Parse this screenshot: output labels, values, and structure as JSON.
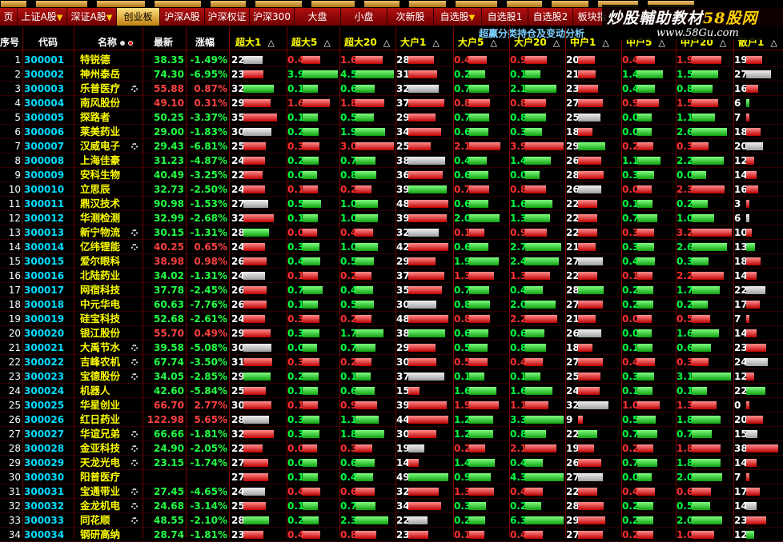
{
  "watermark": {
    "line1a": "炒股輔助教材",
    "line1b": "58股网",
    "line2": "www.58Gu.com"
  },
  "tabs": [
    {
      "label": "页"
    },
    {
      "label": "上证A股",
      "arrow": "▼"
    },
    {
      "label": "深证A股",
      "arrow": "▼"
    },
    {
      "label": "创业板",
      "active": true
    },
    {
      "label": "沪深A股"
    },
    {
      "label": "沪深权证"
    },
    {
      "label": "沪深300"
    },
    {
      "label": "大盘"
    },
    {
      "label": "小盘"
    },
    {
      "label": "次新股"
    },
    {
      "label": "自选股",
      "arrow": "▼"
    },
    {
      "label": "自选股1"
    },
    {
      "label": "自选股2"
    },
    {
      "label": "板块指"
    }
  ],
  "subtitle": "超赢分类持仓及变动分析",
  "columns": {
    "seq": "序号",
    "code": "代码",
    "name": "名称",
    "price": "最新",
    "pct": "涨幅",
    "groups": [
      "超大1",
      "超大5",
      "超大20",
      "大户1",
      "大户5",
      "大户20",
      "中户1",
      "中户5",
      "中户20",
      "散户1"
    ],
    "sort_icon": "△"
  },
  "colors": {
    "up": "#ff4040",
    "down": "#22ff44",
    "code": "#00ddff",
    "name": "#ffff00"
  },
  "rows": [
    {
      "seq": "1",
      "code": "300001",
      "name": "特锐德",
      "price": "38.35",
      "pct": "-1.49%",
      "gear": false,
      "n": [
        22,
        "0.4",
        "1.6",
        28,
        "0.4",
        "0.9",
        20,
        "0.4",
        "1.9",
        19
      ]
    },
    {
      "seq": "2",
      "code": "300002",
      "name": "神州泰岳",
      "price": "74.30",
      "pct": "-6.95%",
      "gear": false,
      "n": [
        23,
        "3.9",
        "4.5",
        31,
        "0.2",
        "0.1",
        21,
        "1.4",
        "1.5",
        27
      ]
    },
    {
      "seq": "3",
      "code": "300003",
      "name": "乐普医疗",
      "price": "55.88",
      "pct": "0.87%",
      "gear": true,
      "n": [
        32,
        "0.1",
        "0.6",
        32,
        "0.7",
        "2.1",
        23,
        "0.4",
        "0.8",
        16
      ]
    },
    {
      "seq": "4",
      "code": "300004",
      "name": "南风股份",
      "price": "49.10",
      "pct": "0.31%",
      "gear": false,
      "n": [
        29,
        "1.6",
        "1.8",
        37,
        "0.8",
        "0.8",
        27,
        "0.9",
        "1.5",
        6
      ]
    },
    {
      "seq": "5",
      "code": "300005",
      "name": "探路者",
      "price": "50.25",
      "pct": "-3.37%",
      "gear": false,
      "n": [
        35,
        "0.1",
        "0.5",
        29,
        "0.7",
        "0.8",
        25,
        "0.0",
        "1.1",
        7
      ]
    },
    {
      "seq": "6",
      "code": "300006",
      "name": "莱美药业",
      "price": "29.00",
      "pct": "-1.83%",
      "gear": false,
      "n": [
        30,
        "0.2",
        "1.9",
        34,
        "0.6",
        "0.3",
        18,
        "0.0",
        "2.6",
        18
      ]
    },
    {
      "seq": "7",
      "code": "300007",
      "name": "汉威电子",
      "price": "29.43",
      "pct": "-6.81%",
      "gear": true,
      "n": [
        25,
        "0.3",
        "3.0",
        25,
        "2.1",
        "3.9",
        29,
        "0.2",
        "0.3",
        20
      ]
    },
    {
      "seq": "8",
      "code": "300008",
      "name": "上海佳豪",
      "price": "31.23",
      "pct": "-4.87%",
      "gear": false,
      "n": [
        24,
        "0.2",
        "0.7",
        38,
        "0.4",
        "1.4",
        26,
        "1.1",
        "2.2",
        12
      ]
    },
    {
      "seq": "9",
      "code": "300009",
      "name": "安科生物",
      "price": "40.49",
      "pct": "-3.25%",
      "gear": false,
      "n": [
        22,
        "0.0",
        "0.8",
        36,
        "0.6",
        "0.0",
        28,
        "0.3",
        "0.0",
        14
      ]
    },
    {
      "seq": "10",
      "code": "300010",
      "name": "立思辰",
      "price": "32.73",
      "pct": "-2.50%",
      "gear": false,
      "n": [
        24,
        "0.1",
        "0.2",
        39,
        "0.7",
        "0.8",
        26,
        "0.0",
        "2.3",
        16
      ]
    },
    {
      "seq": "11",
      "code": "300011",
      "name": "鼎汉技术",
      "price": "90.98",
      "pct": "-1.53%",
      "gear": false,
      "n": [
        27,
        "0.5",
        "1.0",
        48,
        "0.6",
        "1.6",
        22,
        "0.1",
        "0.2",
        3
      ]
    },
    {
      "seq": "12",
      "code": "300012",
      "name": "华测检测",
      "price": "32.99",
      "pct": "-2.68%",
      "gear": false,
      "n": [
        32,
        "0.1",
        "1.0",
        39,
        "2.0",
        "1.3",
        22,
        "0.7",
        "1.0",
        6
      ]
    },
    {
      "seq": "13",
      "code": "300013",
      "name": "新宁物流",
      "price": "30.15",
      "pct": "-1.31%",
      "gear": true,
      "n": [
        28,
        "0.0",
        "0.4",
        32,
        "0.1",
        "0.9",
        22,
        "0.3",
        "3.2",
        10
      ]
    },
    {
      "seq": "14",
      "code": "300014",
      "name": "亿纬锂能",
      "price": "40.25",
      "pct": "0.65%",
      "gear": true,
      "n": [
        24,
        "0.3",
        "1.0",
        42,
        "0.6",
        "2.7",
        21,
        "0.3",
        "2.6",
        13
      ]
    },
    {
      "seq": "15",
      "code": "300015",
      "name": "爱尔眼科",
      "price": "38.98",
      "pct": "0.98%",
      "gear": false,
      "n": [
        26,
        "0.4",
        "0.5",
        29,
        "1.9",
        "2.4",
        27,
        "0.4",
        "0.3",
        18
      ]
    },
    {
      "seq": "16",
      "code": "300016",
      "name": "北陆药业",
      "price": "34.02",
      "pct": "-1.31%",
      "gear": false,
      "n": [
        24,
        "0.1",
        "0.2",
        37,
        "1.3",
        "1.3",
        22,
        "0.1",
        "2.2",
        14
      ]
    },
    {
      "seq": "17",
      "code": "300017",
      "name": "网宿科技",
      "price": "37.78",
      "pct": "-2.45%",
      "gear": false,
      "n": [
        26,
        "0.7",
        "0.4",
        35,
        "0.7",
        "0.4",
        28,
        "0.2",
        "1.7",
        22
      ]
    },
    {
      "seq": "18",
      "code": "300018",
      "name": "中元华电",
      "price": "60.63",
      "pct": "-7.76%",
      "gear": false,
      "n": [
        26,
        "0.1",
        "0.5",
        30,
        "0.8",
        "2.0",
        27,
        "0.2",
        "0.2",
        17
      ]
    },
    {
      "seq": "19",
      "code": "300019",
      "name": "硅宝科技",
      "price": "52.68",
      "pct": "-2.61%",
      "gear": false,
      "n": [
        24,
        "0.3",
        "0.2",
        48,
        "0.8",
        "2.2",
        21,
        "0.0",
        "0.5",
        7
      ]
    },
    {
      "seq": "20",
      "code": "300020",
      "name": "银江股份",
      "price": "55.70",
      "pct": "0.49%",
      "gear": false,
      "n": [
        29,
        "0.3",
        "1.7",
        38,
        "0.6",
        "0.6",
        26,
        "0.0",
        "1.6",
        14
      ]
    },
    {
      "seq": "21",
      "code": "300021",
      "name": "大禹节水",
      "price": "39.58",
      "pct": "-5.08%",
      "gear": true,
      "n": [
        30,
        "0.0",
        "0.7",
        29,
        "0.5",
        "0.8",
        18,
        "0.1",
        "0.6",
        23
      ]
    },
    {
      "seq": "22",
      "code": "300022",
      "name": "吉峰农机",
      "price": "67.74",
      "pct": "-3.50%",
      "gear": true,
      "n": [
        31,
        "0.3",
        "0.2",
        30,
        "0.5",
        "0.4",
        27,
        "0.4",
        "0.3",
        24
      ]
    },
    {
      "seq": "23",
      "code": "300023",
      "name": "宝德股份",
      "price": "34.05",
      "pct": "-2.85%",
      "gear": true,
      "n": [
        29,
        "0.2",
        "0.1",
        37,
        "0.1",
        "0.1",
        25,
        "0.3",
        "3.1",
        12
      ]
    },
    {
      "seq": "24",
      "code": "300024",
      "name": "机器人",
      "price": "42.60",
      "pct": "-5.84%",
      "gear": false,
      "n": [
        25,
        "0.1",
        "0.6",
        15,
        "1.6",
        "1.6",
        24,
        "0.1",
        "0.1",
        22
      ]
    },
    {
      "seq": "25",
      "code": "300025",
      "name": "华星创业",
      "price": "66.70",
      "pct": "2.77%",
      "gear": false,
      "n": [
        30,
        "0.1",
        "0.9",
        39,
        "1.9",
        "1.1",
        32,
        "1.0",
        "1.3",
        0
      ]
    },
    {
      "seq": "26",
      "code": "300026",
      "name": "红日药业",
      "price": "122.98",
      "pct": "5.65%",
      "gear": false,
      "n": [
        28,
        "0.3",
        "1.1",
        44,
        "1.2",
        "3.3",
        9,
        "0.5",
        "1.8",
        20
      ]
    },
    {
      "seq": "27",
      "code": "300027",
      "name": "华谊兄弟",
      "price": "66.66",
      "pct": "-1.81%",
      "gear": true,
      "n": [
        32,
        "0.3",
        "1.8",
        30,
        "1.2",
        "0.8",
        22,
        "0.7",
        "0.7",
        15
      ]
    },
    {
      "seq": "28",
      "code": "300028",
      "name": "金亚科技",
      "price": "24.90",
      "pct": "-2.05%",
      "gear": true,
      "n": [
        22,
        "0.0",
        "0.3",
        19,
        "0.2",
        "2.1",
        19,
        "0.2",
        "1.8",
        38
      ]
    },
    {
      "seq": "29",
      "code": "300029",
      "name": "天龙光电",
      "price": "23.15",
      "pct": "-1.74%",
      "gear": true,
      "n": [
        27,
        "0.0",
        "0.6",
        14,
        "1.4",
        "0.4",
        26,
        "0.7",
        "1.8",
        14
      ]
    },
    {
      "seq": "30",
      "code": "300030",
      "name": "阳普医疗",
      "price": "",
      "pct": "",
      "gear": false,
      "n": [
        27,
        "0.1",
        "0.4",
        49,
        "0.9",
        "4.3",
        27,
        "0.0",
        "2.0",
        7
      ]
    },
    {
      "seq": "31",
      "code": "300031",
      "name": "宝通带业",
      "price": "27.45",
      "pct": "-4.65%",
      "gear": true,
      "n": [
        24,
        "0.4",
        "0.6",
        32,
        "1.3",
        "0.4",
        22,
        "0.4",
        "0.6",
        17
      ]
    },
    {
      "seq": "32",
      "code": "300032",
      "name": "金龙机电",
      "price": "24.68",
      "pct": "-3.14%",
      "gear": true,
      "n": [
        25,
        "0.1",
        "0.7",
        34,
        "0.3",
        "0.2",
        28,
        "0.2",
        "0.5",
        14
      ]
    },
    {
      "seq": "33",
      "code": "300033",
      "name": "同花顺",
      "price": "48.55",
      "pct": "-2.10%",
      "gear": true,
      "n": [
        28,
        "0.2",
        "2.3",
        22,
        "0.2",
        "6.3",
        29,
        "0.2",
        "2.0",
        23
      ]
    },
    {
      "seq": "34",
      "code": "300034",
      "name": "钢研高纳",
      "price": "28.74",
      "pct": "-1.81%",
      "gear": false,
      "n": [
        23,
        "0.4",
        "0.8",
        23,
        "0.1",
        "0.4",
        27,
        "0.2",
        "1.0",
        12
      ]
    }
  ]
}
